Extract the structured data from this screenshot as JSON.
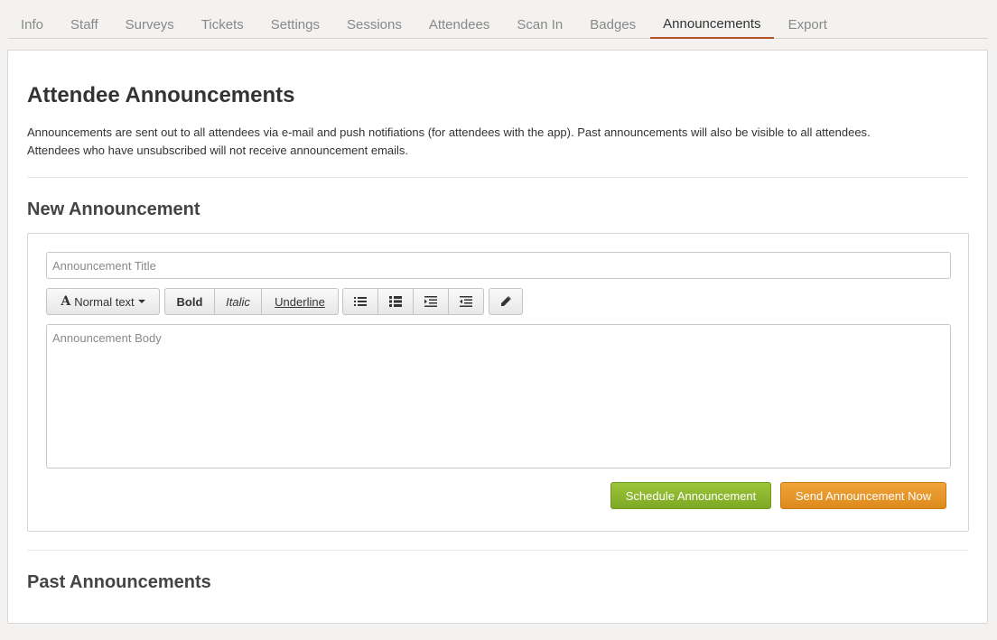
{
  "tabs": [
    {
      "label": "Info"
    },
    {
      "label": "Staff"
    },
    {
      "label": "Surveys"
    },
    {
      "label": "Tickets"
    },
    {
      "label": "Settings"
    },
    {
      "label": "Sessions"
    },
    {
      "label": "Attendees"
    },
    {
      "label": "Scan In"
    },
    {
      "label": "Badges"
    },
    {
      "label": "Announcements",
      "active": true
    },
    {
      "label": "Export"
    }
  ],
  "page": {
    "title": "Attendee Announcements",
    "description_line1": "Announcements are sent out to all attendees via e-mail and push notifiations (for attendees with the app). Past announcements will also be visible to all attendees.",
    "description_line2": "Attendees who have unsubscribed will not receive announcement emails."
  },
  "new_announcement": {
    "heading": "New Announcement",
    "title_placeholder": "Announcement Title",
    "title_value": "",
    "body_placeholder": "Announcement Body",
    "toolbar": {
      "font_style": "Normal text",
      "bold": "Bold",
      "italic": "Italic",
      "underline": "Underline",
      "icons": [
        "unordered-list-icon",
        "ordered-list-icon",
        "indent-icon",
        "outdent-icon",
        "pencil-icon"
      ]
    },
    "schedule_label": "Schedule Announcement",
    "send_label": "Send Announcement Now"
  },
  "past_announcements": {
    "heading": "Past Announcements"
  },
  "colors": {
    "active_tab_underline": "#b5502a",
    "schedule_button": "#8db82e",
    "send_button": "#e8982c"
  }
}
